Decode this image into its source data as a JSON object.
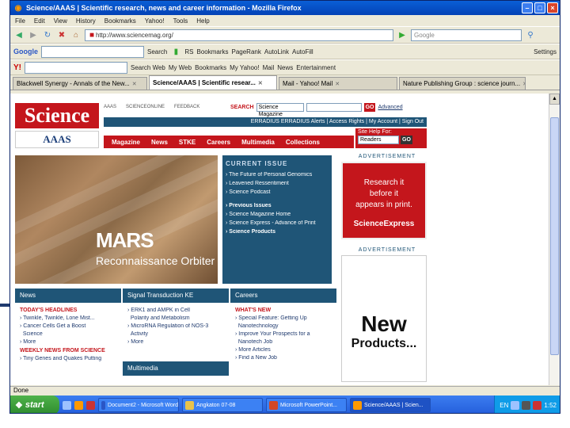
{
  "window": {
    "title": "Science/AAAS | Scientific research, news and career information - Mozilla Firefox"
  },
  "menu": [
    "File",
    "Edit",
    "View",
    "History",
    "Bookmarks",
    "Yahoo!",
    "Tools",
    "Help"
  ],
  "navbar": {
    "url": "http://www.sciencemag.org/",
    "search_placeholder": "Google"
  },
  "google_bar": {
    "label": "Google",
    "search_btn": "Search",
    "items": [
      "RS",
      "Bookmarks",
      "PageRank",
      "AutoLink",
      "AutoFill"
    ],
    "settings": "Settings"
  },
  "yahoo_bar": {
    "search_btn": "Search Web",
    "items": [
      "My Web",
      "Bookmarks",
      "My Yahoo!",
      "Mail",
      "News",
      "Entertainment"
    ]
  },
  "tabs": [
    "Blackwell Synergy - Annals of the New...",
    "Science/AAAS | Scientific resear...",
    "Mail - Yahoo! Mail",
    "Nature Publishing Group : science journ..."
  ],
  "status": "Done",
  "taskbar": {
    "start": "start",
    "tasks": [
      "Document2 - Microsoft Word",
      "Angkaton 07-08",
      "Microsoft PowerPoint...",
      "Science/AAAS | Scien..."
    ],
    "lang": "EN",
    "clock": "1:52"
  },
  "science": {
    "logo": "Science",
    "aaas": "AAAS",
    "toplinks": [
      "AAAS",
      "SCIENCEONLINE",
      "FEEDBACK"
    ],
    "search_label": "SEARCH",
    "search_option": "Science Magazine",
    "go": "GO",
    "advanced": "Advanced",
    "userbar": "ERRADIUS ERRADIUS Alerts | Access Rights | My Account | Sign Out",
    "help_label": "Site Help For:",
    "help_option": "Readers",
    "nav": [
      "Magazine",
      "News",
      "STKE",
      "Careers",
      "Multimedia",
      "Collections"
    ],
    "hero_title": "MARS",
    "hero_sub": "Reconnaissance Orbiter",
    "current_issue": "CURRENT ISSUE",
    "issue_items": [
      "The Future of Personal Genomics",
      "Leavened Ressentiment",
      "Science Podcast",
      "Previous Issues",
      "Science Magazine Home",
      "Science Express - Advance of Print",
      "Science Products"
    ],
    "ad_label": "ADVERTISEMENT",
    "ad_text": [
      "Research it",
      "before it",
      "appears in print."
    ],
    "ad_brand": "ScienceExpress",
    "ad2_big": "New",
    "ad2_sm": "Products...",
    "news_hdr": "News",
    "news_sub1": "TODAY'S HEADLINES",
    "news_items": [
      "Twinkle, Twinkle, Lone Mist...",
      "Cancer Cells Get a Boost",
      "Science",
      "More"
    ],
    "news_sub2": "WEEKLY NEWS FROM SCIENCE",
    "news_items2": [
      "Tiny Genes and Quakes Putting"
    ],
    "signal_hdr": "Signal Transduction KE",
    "signal_items": [
      "ERK1 and AMPK in Cell",
      "Polarity and Metabolism",
      "MicroRNA Regulation of NOS-3",
      "Activity",
      "More"
    ],
    "multimedia_hdr": "Multimedia",
    "careers_hdr": "Careers",
    "careers_sub": "WHAT'S NEW",
    "careers_items": [
      "Special Feature: Getting Up",
      "Nanotechnology",
      "Improve Your Prospects for a",
      "Nanotech Job",
      "More Articles",
      "Find a New Job"
    ]
  }
}
